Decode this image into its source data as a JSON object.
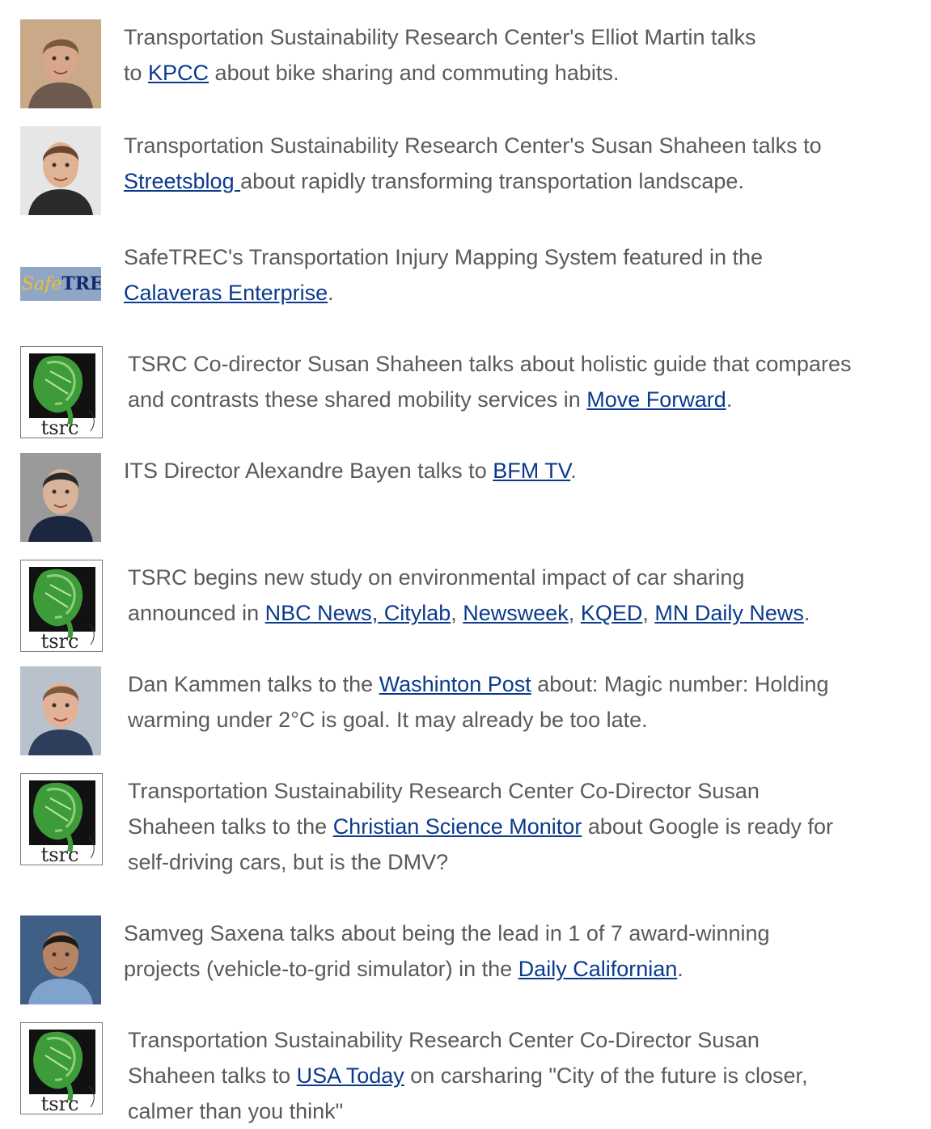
{
  "items": [
    {
      "thumb": "photo-elliot-martin",
      "lines": [
        [
          {
            "t": "Transportation Sustainability Research Center's Elliot Martin talks"
          }
        ],
        [
          {
            "t": "to "
          },
          {
            "t": "KPCC",
            "link": true
          },
          {
            "t": " about bike sharing and commuting habits."
          }
        ]
      ]
    },
    {
      "thumb": "photo-susan-shaheen",
      "lines": [
        [
          {
            "t": "Transportation Sustainability Research Center's Susan Shaheen talks to"
          }
        ],
        [
          {
            "t": "Streetsblog ",
            "link": true
          },
          {
            "t": "about rapidly transforming transportation landscape."
          }
        ]
      ]
    },
    {
      "thumb": "safetrec-logo",
      "logo_text": {
        "safe": "Safe",
        "trec": "TREC"
      },
      "lines": [
        [
          {
            "t": "SafeTREC's Transportation Injury Mapping System featured in the"
          }
        ],
        [
          {
            "t": "Calaveras Enterprise",
            "link": true
          },
          {
            "t": "."
          }
        ]
      ]
    },
    {
      "thumb": "tsrc-logo",
      "logo_text": "tsrc",
      "lines": [
        [
          {
            "t": "TSRC Co-director Susan Shaheen talks about holistic guide that compares"
          }
        ],
        [
          {
            "t": "and contrasts these shared mobility services in "
          },
          {
            "t": "Move Forward",
            "link": true
          },
          {
            "t": "."
          }
        ]
      ]
    },
    {
      "thumb": "photo-alexandre-bayen",
      "lines": [
        [
          {
            "t": "ITS Director Alexandre Bayen talks to "
          },
          {
            "t": "BFM TV",
            "link": true
          },
          {
            "t": "."
          }
        ]
      ]
    },
    {
      "thumb": "tsrc-logo",
      "logo_text": "tsrc",
      "lines": [
        [
          {
            "t": "TSRC begins new study on environmental impact of car sharing"
          }
        ],
        [
          {
            "t": "announced in "
          },
          {
            "t": "NBC News",
            "link": true
          },
          {
            "t": ", Citylab",
            "link": true
          },
          {
            "t": ", "
          },
          {
            "t": "Newsweek",
            "link": true
          },
          {
            "t": ", "
          },
          {
            "t": "KQED",
            "link": true
          },
          {
            "t": ", "
          },
          {
            "t": "MN Daily News",
            "link": true
          },
          {
            "t": "."
          }
        ]
      ]
    },
    {
      "thumb": "photo-dan-kammen",
      "lines": [
        [
          {
            "t": "Dan Kammen talks to the "
          },
          {
            "t": "Washinton Post",
            "link": true
          },
          {
            "t": " about: Magic number: Holding"
          }
        ],
        [
          {
            "t": "warming under 2°C is goal. It may already be too late."
          }
        ]
      ]
    },
    {
      "thumb": "tsrc-logo",
      "logo_text": "tsrc",
      "lines": [
        [
          {
            "t": "Transportation Sustainability Research Center Co-Director Susan"
          }
        ],
        [
          {
            "t": "Shaheen talks to the "
          },
          {
            "t": "Christian Science Monitor",
            "link": true
          },
          {
            "t": " about Google is ready for"
          }
        ],
        [
          {
            "t": "self-driving cars, but is the DMV?"
          }
        ]
      ]
    },
    {
      "thumb": "photo-samveg-saxena",
      "lines": [
        [
          {
            "t": "Samveg Saxena talks about being the lead in 1 of 7 award-winning"
          }
        ],
        [
          {
            "t": "projects (vehicle-to-grid simulator) in the "
          },
          {
            "t": "Daily Californian",
            "link": true
          },
          {
            "t": "."
          }
        ]
      ]
    },
    {
      "thumb": "tsrc-logo",
      "logo_text": "tsrc",
      "lines": [
        [
          {
            "t": "Transportation Sustainability Research Center Co-Director Susan"
          }
        ],
        [
          {
            "t": "Shaheen talks to "
          },
          {
            "t": "USA Today",
            "link": true
          },
          {
            "t": " on carsharing \"City of the future is closer,"
          }
        ],
        [
          {
            "t": "calmer than you think\""
          }
        ]
      ]
    }
  ],
  "colors": {
    "text": "#5a5a5a",
    "link": "#0b3a8c"
  }
}
